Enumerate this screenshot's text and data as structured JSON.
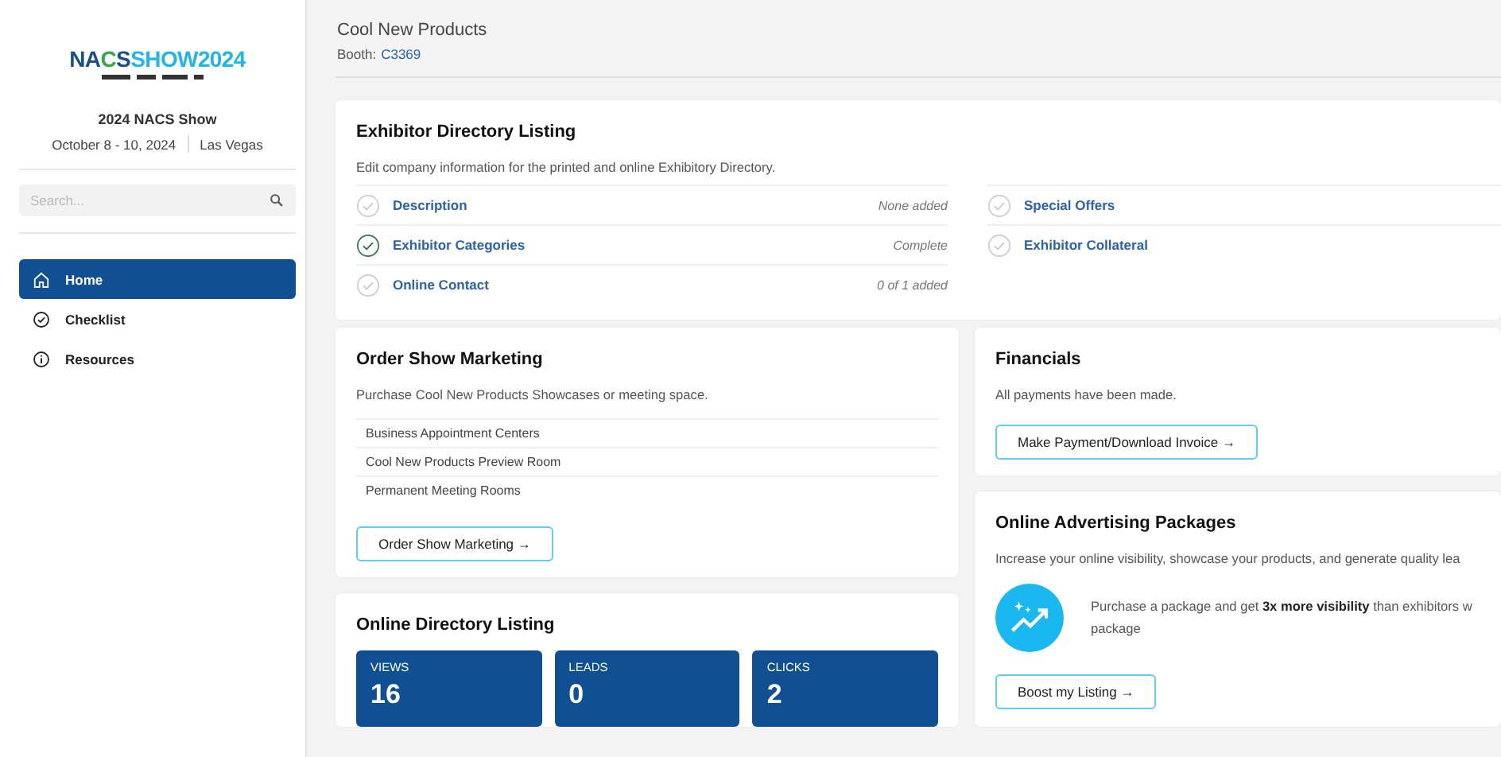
{
  "sidebar": {
    "logo": {
      "parts": [
        {
          "text": "NA",
          "color": "#1b4f8c"
        },
        {
          "text": "C",
          "color": "#3aa84a"
        },
        {
          "text": "S",
          "color": "#1b4f8c"
        },
        {
          "text": "SHOW2024",
          "color": "#22b5e8"
        }
      ]
    },
    "event_name": "2024 NACS Show",
    "event_dates": "October 8 - 10, 2024",
    "event_location": "Las Vegas",
    "search": {
      "placeholder": "Search..."
    },
    "nav": [
      {
        "label": "Home",
        "selected": true
      },
      {
        "label": "Checklist",
        "selected": false
      },
      {
        "label": "Resources",
        "selected": false
      }
    ]
  },
  "header": {
    "title": "Cool New Products",
    "booth_label": "Booth:",
    "booth": "C3369"
  },
  "directory": {
    "title": "Exhibitor Directory Listing",
    "description": "Edit company information for the printed and online Exhibitory Directory.",
    "items": [
      {
        "label": "Description",
        "status": "None added",
        "complete": false
      },
      {
        "label": "Exhibitor Categories",
        "status": "Complete",
        "complete": true
      },
      {
        "label": "Online Contact",
        "status": "0 of 1 added",
        "complete": false
      },
      {
        "label": "Special Offers",
        "complete": false
      },
      {
        "label": "Exhibitor Collateral",
        "complete": false
      }
    ]
  },
  "marketing": {
    "title": "Order Show Marketing",
    "description": "Purchase Cool New Products Showcases or meeting space.",
    "items": [
      "Business Appointment Centers",
      "Cool New Products Preview Room",
      "Permanent Meeting Rooms"
    ],
    "button": "Order Show Marketing →"
  },
  "online_listing": {
    "title": "Online Directory Listing",
    "stats": [
      {
        "label": "VIEWS",
        "value": "16"
      },
      {
        "label": "LEADS",
        "value": "0"
      },
      {
        "label": "CLICKS",
        "value": "2"
      }
    ]
  },
  "financials": {
    "title": "Financials",
    "description": "All payments have been made.",
    "button": "Make Payment/Download Invoice →"
  },
  "advertising": {
    "title": "Online Advertising Packages",
    "description": "Increase your online visibility, showcase your products, and generate quality lea",
    "promo_lines": [
      "Purchase a package and get **3x more visibility** than exhibitors w",
      "package"
    ],
    "button": "Boost my Listing →"
  }
}
